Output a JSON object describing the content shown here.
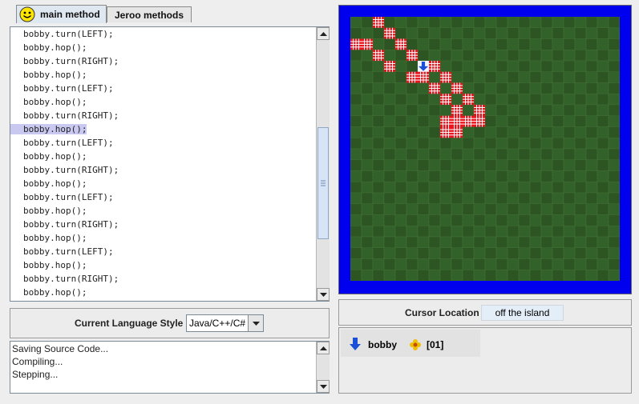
{
  "tabs": [
    {
      "label": "main method",
      "active": true,
      "icon": "smiley-icon"
    },
    {
      "label": "Jeroo methods",
      "active": false
    }
  ],
  "editor": {
    "lines": [
      "bobby.turn(LEFT);",
      "bobby.hop();",
      "bobby.turn(RIGHT);",
      "bobby.hop();",
      "bobby.turn(LEFT);",
      "bobby.hop();",
      "bobby.turn(RIGHT);",
      "bobby.hop();",
      "bobby.turn(LEFT);",
      "bobby.hop();",
      "bobby.turn(RIGHT);",
      "bobby.hop();",
      "bobby.turn(LEFT);",
      "bobby.hop();",
      "bobby.turn(RIGHT);",
      "bobby.hop();",
      "bobby.turn(LEFT);",
      "bobby.hop();",
      "bobby.turn(RIGHT);",
      "bobby.hop();"
    ],
    "highlighted_line": 7
  },
  "language": {
    "label": "Current Language Style",
    "value": "Java/C++/C#"
  },
  "console": {
    "lines": [
      "Saving Source Code...",
      "Compiling...",
      "Stepping..."
    ]
  },
  "cursor": {
    "label": "Cursor Location",
    "value": "off the island"
  },
  "jeroo_status": {
    "name": "bobby",
    "flowers": "[01]",
    "direction_icon": "down-arrow-icon",
    "flower_icon": "flower-icon"
  },
  "island": {
    "cols": 24,
    "rows": 24,
    "water_color": "#0000ee",
    "grass_color": "#2f5a25",
    "net_color": "#e8141e",
    "nets": [
      [
        2,
        0
      ],
      [
        3,
        1
      ],
      [
        0,
        2
      ],
      [
        1,
        2
      ],
      [
        2,
        3
      ],
      [
        3,
        4
      ],
      [
        4,
        2
      ],
      [
        5,
        3
      ],
      [
        6,
        4
      ],
      [
        7,
        4
      ],
      [
        5,
        5
      ],
      [
        6,
        5
      ],
      [
        7,
        6
      ],
      [
        8,
        5
      ],
      [
        9,
        6
      ],
      [
        8,
        7
      ],
      [
        9,
        8
      ],
      [
        10,
        7
      ],
      [
        11,
        8
      ],
      [
        10,
        9
      ],
      [
        9,
        9
      ],
      [
        11,
        9
      ],
      [
        8,
        10
      ],
      [
        9,
        10
      ],
      [
        8,
        9
      ]
    ],
    "jeroo": [
      6,
      4
    ]
  },
  "colors": {
    "highlight": "#c8c8f0",
    "panel": "#eeeeee",
    "accent_arrow": "#1a4fd6"
  }
}
